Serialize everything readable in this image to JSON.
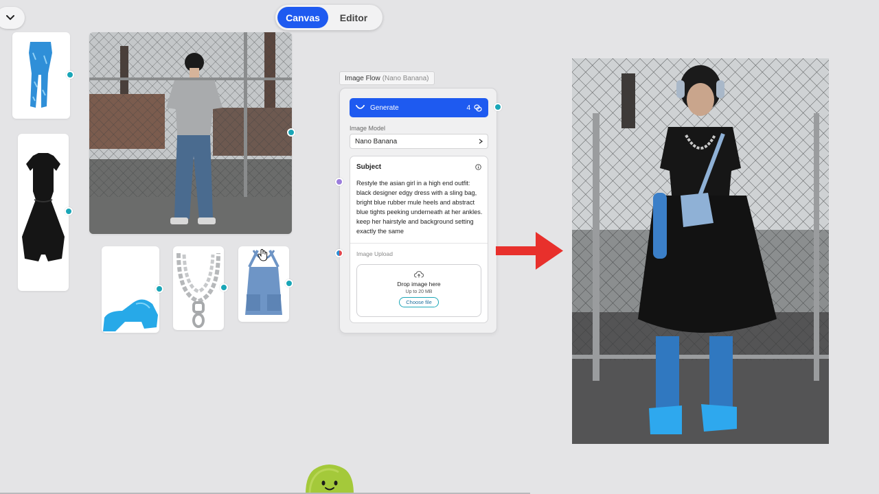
{
  "mode_toggle": {
    "canvas_label": "Canvas",
    "editor_label": "Editor",
    "active": "Canvas"
  },
  "flow": {
    "tag_title": "Image Flow",
    "tag_sub": "(Nano Banana)",
    "generate_label": "Generate",
    "generate_count": "4",
    "image_model_label": "Image Model",
    "image_model_value": "Nano Banana",
    "subject_title": "Subject",
    "subject_text": "Restyle the asian girl in a high end outfit: black designer edgy dress with a sling bag, bright blue rubber mule heels and abstract blue tights peeking underneath at her ankles. keep her hairstyle and background setting exactly the same",
    "upload_label": "Image Upload",
    "drop_title": "Drop image here",
    "drop_limit": "Up to 20 MB",
    "choose_label": "Choose file"
  },
  "colors": {
    "accent": "#1e5af0",
    "connector": "#1aa6b7",
    "arrow": "#e8302c",
    "background": "#e4e4e6"
  },
  "icons": [
    "chevron-down-icon",
    "generate-smile-icon",
    "credits-icon",
    "chevron-right-icon",
    "info-icon",
    "cloud-upload-icon",
    "hand-cursor-icon",
    "arrow-right-icon",
    "mascot-icon"
  ]
}
